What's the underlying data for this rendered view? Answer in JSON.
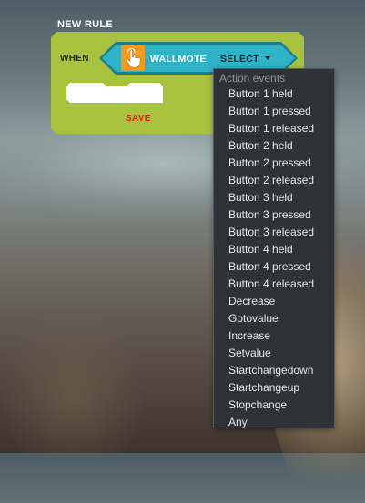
{
  "rule": {
    "title": "NEW RULE",
    "when_label": "WHEN",
    "device_name": "WALLMOTE",
    "device_icon": "hand-touch-icon",
    "select_label": "SELECT",
    "save_label": "SAVE"
  },
  "colors": {
    "rule_block": "#a8c23d",
    "device_pill": "#2eb3c7",
    "device_icon_bg": "#f39a1e",
    "save": "#d8241d",
    "dropdown_bg": "#2f3236"
  },
  "dropdown": {
    "header": "Action events",
    "items": [
      "Button 1 held",
      "Button 1 pressed",
      "Button 1 released",
      "Button 2 held",
      "Button 2 pressed",
      "Button 2 released",
      "Button 3 held",
      "Button 3 pressed",
      "Button 3 released",
      "Button 4 held",
      "Button 4 pressed",
      "Button 4 released",
      "Decrease",
      "Gotovalue",
      "Increase",
      "Setvalue",
      "Startchangedown",
      "Startchangeup",
      "Stopchange",
      "Any"
    ]
  }
}
